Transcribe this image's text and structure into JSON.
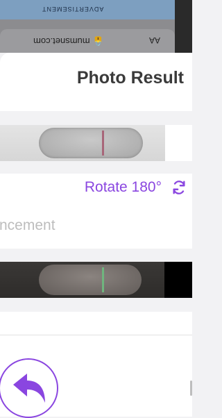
{
  "browser": {
    "ad_label": "ADVERTISEMENT",
    "url_text": "🔒 mumsnet.com",
    "aa_label": "AA"
  },
  "header": {
    "title": "Photo Result"
  },
  "controls": {
    "rotate_label": "Rotate 180°",
    "enhance_label": "ncement"
  },
  "icons": {
    "rotate": "rotate-arrows-icon",
    "back": "reply-arrow-icon"
  },
  "colors": {
    "accent": "#8a46e0",
    "line_red": "#a86679",
    "line_green": "#6fb57e"
  }
}
